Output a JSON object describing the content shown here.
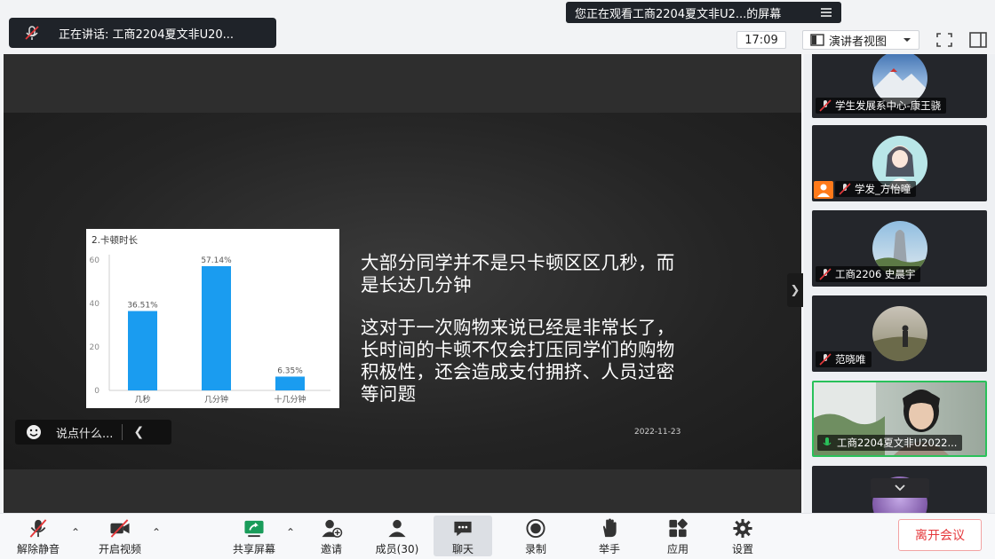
{
  "top": {
    "speaking_text": "正在讲话: 工商2204夏文非U20...",
    "viewing_text": "您正在观看工商2204夏文非U2...的屏幕",
    "clock": "17:09",
    "view_mode": "演讲者视图"
  },
  "slide": {
    "paragraph1_line1": "大部分同学并不是只卡顿区区几秒，而",
    "paragraph1_line2": "是长达几分钟",
    "paragraph2_line1": "这对于一次购物来说已经是非常长了，",
    "paragraph2_line2": "长时间的卡顿不仅会打压同学们的购物",
    "paragraph2_line3": "积极性，还会造成支付拥挤、人员过密",
    "paragraph2_line4": "等问题",
    "date": "2022-11-23",
    "chat_placeholder": "说点什么..."
  },
  "chart_data": {
    "type": "bar",
    "title": "2.卡顿时长",
    "categories": [
      "几秒",
      "几分钟",
      "十几分钟"
    ],
    "values": [
      36.51,
      57.14,
      6.35
    ],
    "data_labels": [
      "36.51%",
      "57.14%",
      "6.35%"
    ],
    "ylim": [
      0,
      60
    ],
    "yticks": [
      0,
      20,
      40,
      60
    ],
    "ytick_labels": [
      "0",
      "20",
      "40",
      "60"
    ],
    "bar_color": "#1a9cf0",
    "grid": false
  },
  "participants": [
    {
      "name": "学生发展系中心-康王骁",
      "avatar": "landscape-avatar"
    },
    {
      "name": "学发_方怡曈",
      "avatar": "anime-girl-avatar"
    },
    {
      "name": "工商2206 史晨宇",
      "avatar": "sculpture-avatar"
    },
    {
      "name": "范晓唯",
      "avatar": "outdoor-person-avatar"
    },
    {
      "name": "工商2204夏文非U2022...",
      "avatar": "video-feed"
    },
    {
      "name": "",
      "avatar": "purple-avatar"
    }
  ],
  "toolbar": {
    "unmute": "解除静音",
    "start_video": "开启视频",
    "share_screen": "共享屏幕",
    "invite": "邀请",
    "members": "成员(30)",
    "chat": "聊天",
    "record": "录制",
    "raise_hand": "举手",
    "apps": "应用",
    "settings": "设置",
    "leave": "离开会议"
  },
  "colors": {
    "accent_green": "#29c15a",
    "leave_red": "#e5383b",
    "host_orange": "#ff7a1a"
  }
}
